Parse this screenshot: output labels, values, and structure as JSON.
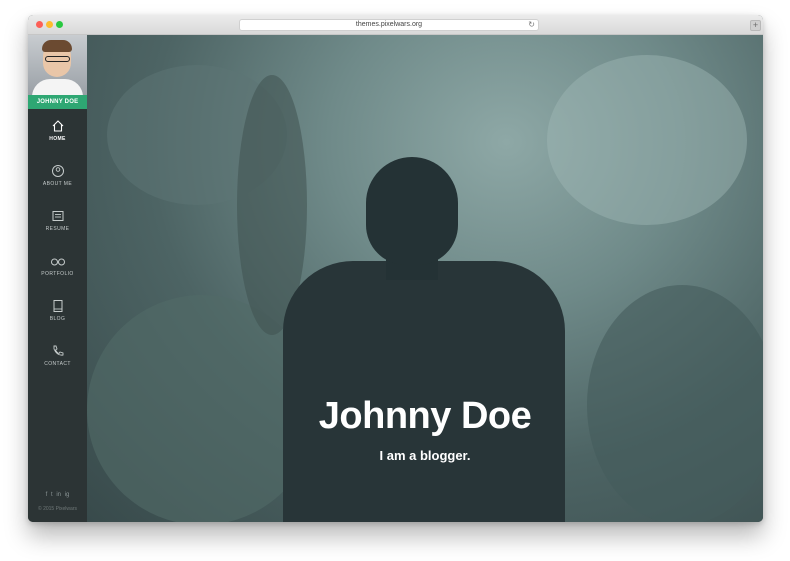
{
  "browser": {
    "url": "themes.pixelwars.org",
    "reload_glyph": "↻",
    "newtab_glyph": "+"
  },
  "profile": {
    "name": "JOHNNY DOE",
    "accent_color": "#2ea773"
  },
  "nav": {
    "home": "HOME",
    "about": "ABOUT ME",
    "resume": "RESUME",
    "portfolio": "PORTFOLIO",
    "blog": "BLOG",
    "contact": "CONTACT",
    "active": "HOME"
  },
  "social": {
    "facebook": "f",
    "twitter": "t",
    "linkedin": "in",
    "instagram": "ig"
  },
  "footer": {
    "copyright": "© 2015 Pixelwars"
  },
  "hero": {
    "title": "Johnny Doe",
    "subtitle": "I am a blogger."
  }
}
